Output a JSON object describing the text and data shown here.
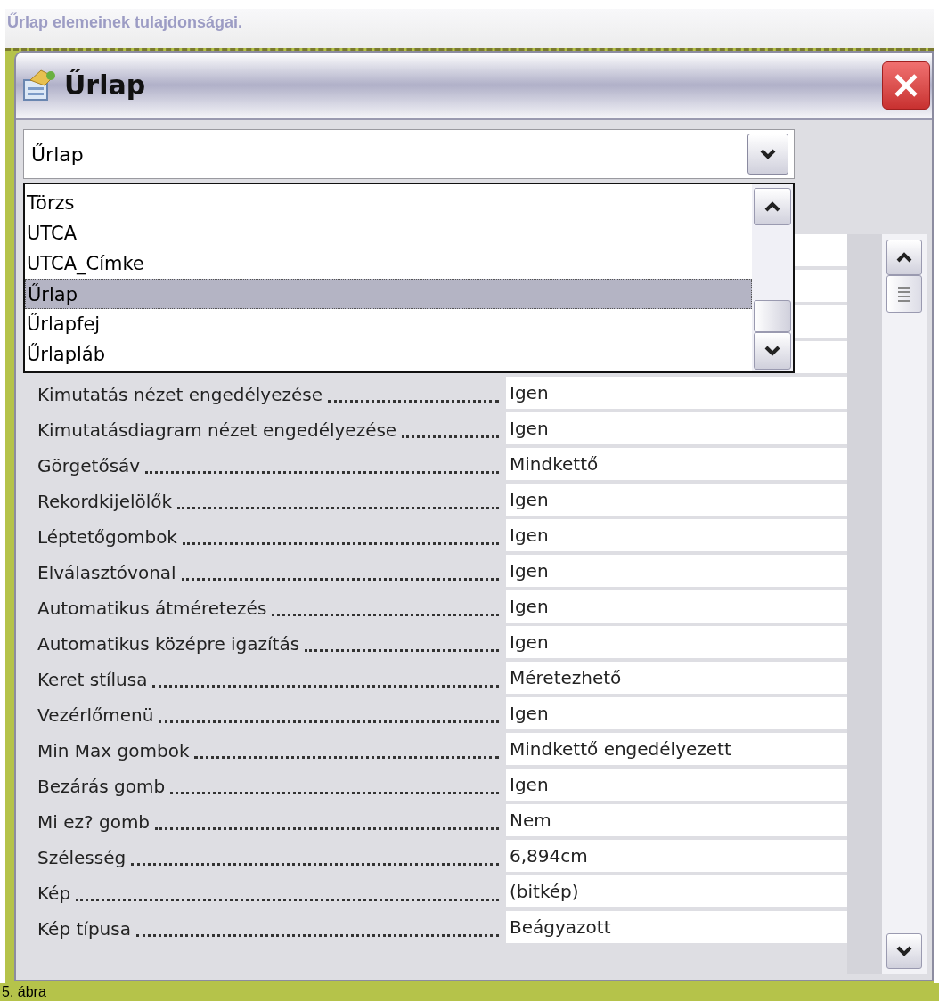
{
  "caption": "Űrlap elemeinek tulajdonságai.",
  "window": {
    "title": "Űrlap"
  },
  "object_combo": {
    "value": "Űrlap"
  },
  "object_list": [
    {
      "label": "Törzs",
      "selected": false
    },
    {
      "label": "UTCA",
      "selected": false
    },
    {
      "label": "UTCA_Címke",
      "selected": false
    },
    {
      "label": "Űrlap",
      "selected": true
    },
    {
      "label": "Űrlapfej",
      "selected": false
    },
    {
      "label": "Űrlapláb",
      "selected": false
    }
  ],
  "properties": [
    {
      "name": "Kimutatás nézet engedélyezése",
      "value": "Igen"
    },
    {
      "name": "Kimutatásdiagram nézet engedélyezése",
      "value": "Igen"
    },
    {
      "name": "Görgetősáv",
      "value": "Mindkettő"
    },
    {
      "name": "Rekordkijelölők",
      "value": "Igen"
    },
    {
      "name": "Léptetőgombok",
      "value": "Igen"
    },
    {
      "name": "Elválasztóvonal",
      "value": "Igen"
    },
    {
      "name": "Automatikus átméretezés",
      "value": "Igen"
    },
    {
      "name": "Automatikus középre igazítás",
      "value": "Igen"
    },
    {
      "name": "Keret stílusa",
      "value": "Méretezhető"
    },
    {
      "name": "Vezérlőmenü",
      "value": "Igen"
    },
    {
      "name": "Min Max gombok",
      "value": "Mindkettő engedélyezett"
    },
    {
      "name": "Bezárás gomb",
      "value": "Igen"
    },
    {
      "name": "Mi ez? gomb",
      "value": "Nem"
    },
    {
      "name": "Szélesség",
      "value": "6,894cm"
    },
    {
      "name": "Kép",
      "value": "(bitkép)"
    },
    {
      "name": "Kép típusa",
      "value": "Beágyazott"
    }
  ],
  "figure_label": "5. ábra"
}
